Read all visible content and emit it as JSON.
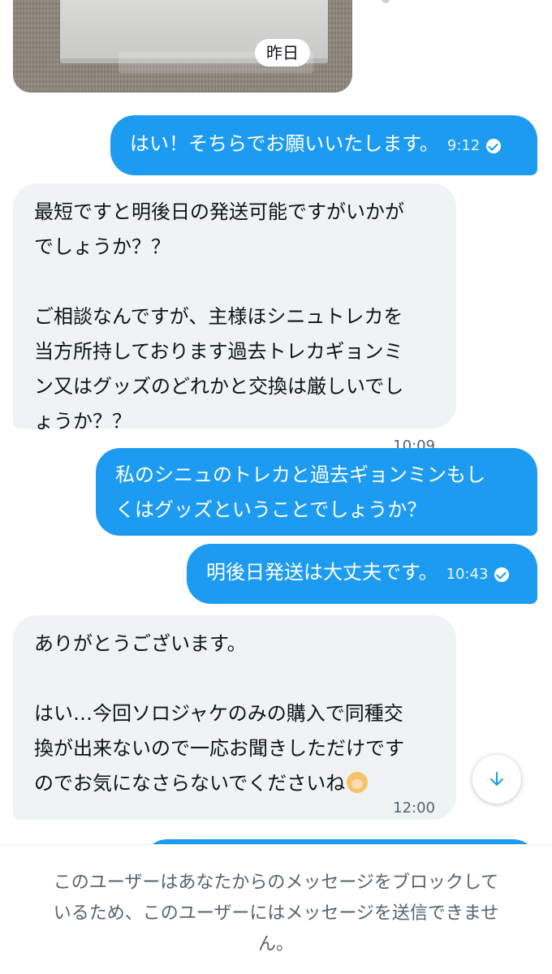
{
  "date_chip": "昨日",
  "messages": [
    {
      "dir": "out",
      "lines": [
        "はい！そちらでお願いいたします。"
      ],
      "time": "9:12",
      "read": true
    },
    {
      "dir": "in",
      "lines": [
        "最短ですと明後日の発送可能ですがいかが",
        "でしょうか？？",
        "",
        "ご相談なんですが、主様ほシニュトレカを",
        "当方所持しております過去トレカギョンミ",
        "ン又はグッズのどれかと交換は厳しいでし",
        "ょうか？？"
      ],
      "time": "10:09"
    },
    {
      "dir": "out",
      "lines": [
        "私のシニュのトレカと過去ギョンミンもし",
        "くはグッズということでしょうか？"
      ]
    },
    {
      "dir": "out",
      "lines": [
        "明後日発送は大丈夫です。"
      ],
      "time": "10:43",
      "read": true
    },
    {
      "dir": "in",
      "lines": [
        "ありがとうございます。",
        "",
        "はい…今回ソロジャケのみの購入で同種交",
        "換が出来ないので一応お聞きしただけです",
        "のでお気になさらないでくださいね"
      ],
      "emoji": "woman-bowing-blonde",
      "time": "12:00"
    }
  ],
  "scroll_button_icon": "arrow-down-icon",
  "footer_notice": [
    "このユーザーはあなたからのメッセージをブロックして",
    "いるため、このユーザーにはメッセージを送信できませ",
    "ん。"
  ],
  "colors": {
    "accent": "#1d9bf0",
    "incoming_bubble": "#eff3f4",
    "muted_text": "#536471"
  }
}
